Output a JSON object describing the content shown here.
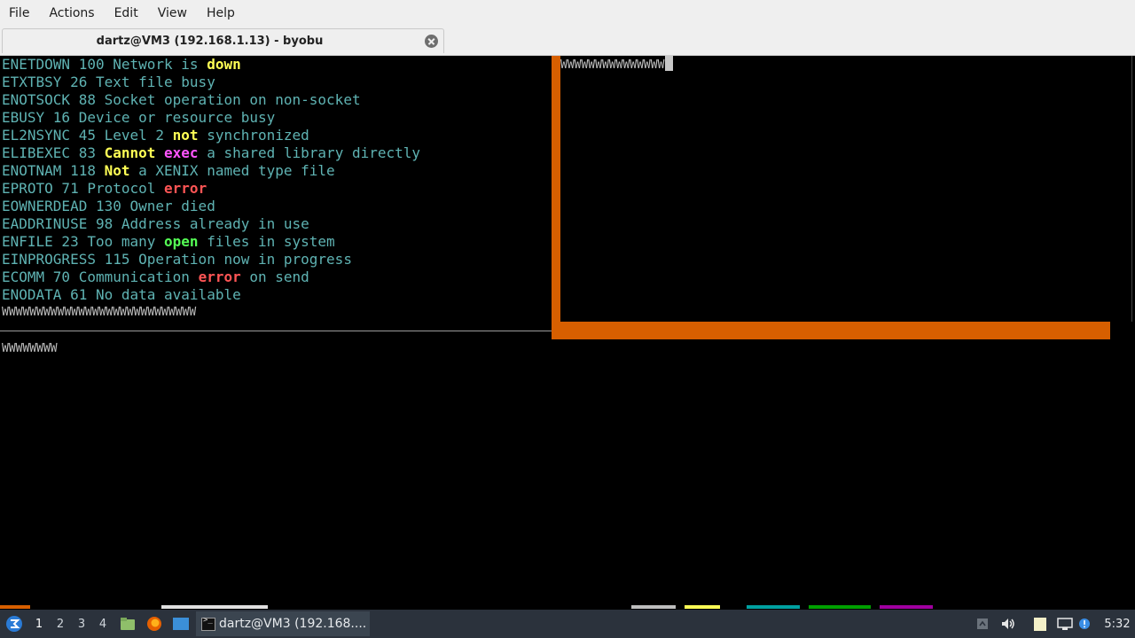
{
  "menubar": {
    "items": [
      "File",
      "Actions",
      "Edit",
      "View",
      "Help"
    ]
  },
  "tab": {
    "title": "dartz@VM3 (192.168.1.13) - byobu"
  },
  "terminal": {
    "lines": [
      [
        [
          "ENETDOWN 100 Network is ",
          ""
        ],
        [
          "down",
          "y"
        ]
      ],
      [
        [
          "ETXTBSY 26 Text file busy",
          ""
        ]
      ],
      [
        [
          "ENOTSOCK 88 Socket operation on non-socket",
          ""
        ]
      ],
      [
        [
          "EBUSY 16 Device or resource busy",
          ""
        ]
      ],
      [
        [
          "EL2NSYNC 45 Level 2 ",
          ""
        ],
        [
          "not",
          "y"
        ],
        [
          " synchronized",
          ""
        ]
      ],
      [
        [
          "ELIBEXEC 83 ",
          ""
        ],
        [
          "Cannot",
          "y"
        ],
        [
          " ",
          ""
        ],
        [
          "exec",
          "m"
        ],
        [
          " a shared library directly",
          ""
        ]
      ],
      [
        [
          "ENOTNAM 118 ",
          ""
        ],
        [
          "Not",
          "y"
        ],
        [
          " a XENIX named type file",
          ""
        ]
      ],
      [
        [
          "EPROTO 71 Protocol ",
          ""
        ],
        [
          "error",
          "r"
        ]
      ],
      [
        [
          "EOWNERDEAD 130 Owner died",
          ""
        ]
      ],
      [
        [
          "EADDRINUSE 98 Address already in use",
          ""
        ]
      ],
      [
        [
          "ENFILE 23 Too many ",
          ""
        ],
        [
          "open",
          "g"
        ],
        [
          " files in system",
          ""
        ]
      ],
      [
        [
          "EINPROGRESS 115 Operation now in progress",
          ""
        ]
      ],
      [
        [
          "ECOMM 70 Communication ",
          ""
        ],
        [
          "error",
          "r"
        ],
        [
          " on send",
          ""
        ]
      ],
      [
        [
          "ENODATA 61 No data available",
          ""
        ]
      ]
    ],
    "pane1_tail": "WWWWWWWWWWWWWWWWWWWWWWWWWWWW",
    "pane2_text": "WWWWWWWWWWWWWWW",
    "pane3_text": "WWWWWWWW"
  },
  "taskbar": {
    "workspaces": [
      "1",
      "2",
      "3",
      "4"
    ],
    "active_workspace": "1",
    "window_label": "dartz@VM3 (192.168....",
    "clock": "5:32"
  },
  "colors": {
    "pane_border": "#d75f00",
    "taskbar_bg": "#2b323c"
  }
}
